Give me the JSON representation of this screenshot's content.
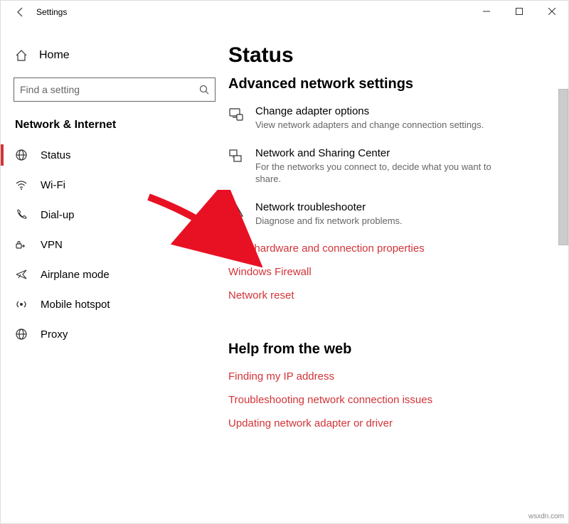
{
  "titlebar": {
    "title": "Settings"
  },
  "sidebar": {
    "home_label": "Home",
    "search_placeholder": "Find a setting",
    "category": "Network & Internet",
    "items": [
      {
        "label": "Status",
        "icon": "status-icon"
      },
      {
        "label": "Wi-Fi",
        "icon": "wifi-icon"
      },
      {
        "label": "Dial-up",
        "icon": "dialup-icon"
      },
      {
        "label": "VPN",
        "icon": "vpn-icon"
      },
      {
        "label": "Airplane mode",
        "icon": "airplane-icon"
      },
      {
        "label": "Mobile hotspot",
        "icon": "hotspot-icon"
      },
      {
        "label": "Proxy",
        "icon": "proxy-icon"
      }
    ]
  },
  "main": {
    "page_title": "Status",
    "section_title": "Advanced network settings",
    "options": [
      {
        "title": "Change adapter options",
        "desc": "View network adapters and change connection settings."
      },
      {
        "title": "Network and Sharing Center",
        "desc": "For the networks you connect to, decide what you want to share."
      },
      {
        "title": "Network troubleshooter",
        "desc": "Diagnose and fix network problems."
      }
    ],
    "links": [
      "View hardware and connection properties",
      "Windows Firewall",
      "Network reset"
    ],
    "help_title": "Help from the web",
    "help_links": [
      "Finding my IP address",
      "Troubleshooting network connection issues",
      "Updating network adapter or driver"
    ]
  },
  "footer": "wsxdn.com"
}
